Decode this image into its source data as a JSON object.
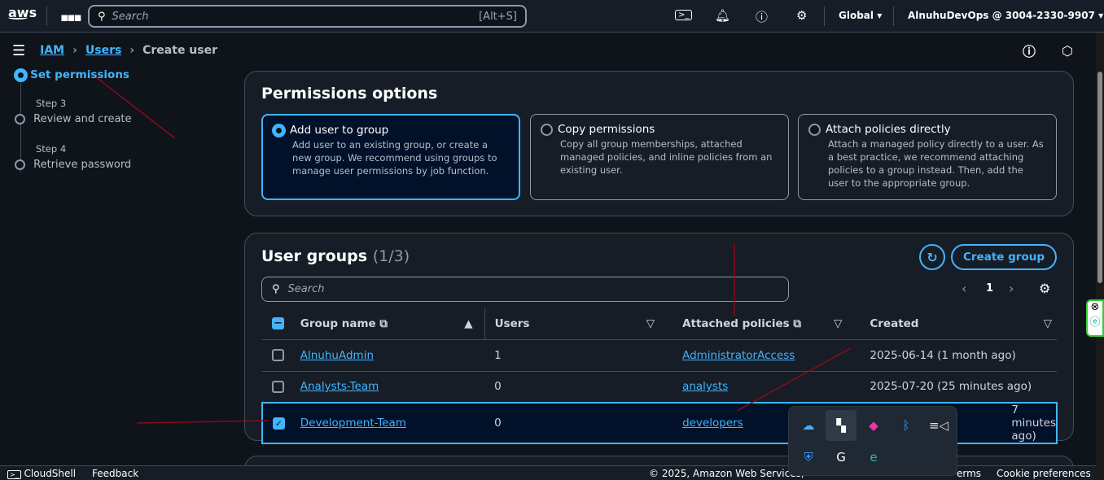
{
  "topbar": {
    "logo": "aws",
    "search_placeholder": "Search",
    "search_shortcut": "[Alt+S]",
    "region": "Global",
    "account": "AlnuhuDevOps @ 3004-2330-9907"
  },
  "breadcrumb": [
    "IAM",
    "Users",
    "Create user"
  ],
  "steps": [
    {
      "title": "Set permissions"
    },
    {
      "num": "Step 3",
      "title": "Review and create"
    },
    {
      "num": "Step 4",
      "title": "Retrieve password"
    }
  ],
  "permissions": {
    "title": "Permissions options",
    "options": [
      {
        "label": "Add user to group",
        "desc": "Add user to an existing group, or create a new group. We recommend using groups to manage user permissions by job function.",
        "selected": true
      },
      {
        "label": "Copy permissions",
        "desc": "Copy all group memberships, attached managed policies, and inline policies from an existing user.",
        "selected": false
      },
      {
        "label": "Attach policies directly",
        "desc": "Attach a managed policy directly to a user. As a best practice, we recommend attaching policies to a group instead. Then, add the user to the appropriate group.",
        "selected": false
      }
    ]
  },
  "groups": {
    "title": "User groups",
    "count": "(1/3)",
    "create_label": "Create group",
    "search_placeholder": "Search",
    "page": "1",
    "columns": [
      "Group name",
      "Users",
      "Attached policies",
      "Created"
    ],
    "rows": [
      {
        "name": "AlnuhuAdmin",
        "users": "1",
        "policy": "AdministratorAccess",
        "created": "2025-06-14 (1 month ago)",
        "checked": false
      },
      {
        "name": "Analysts-Team",
        "users": "0",
        "policy": "analysts",
        "created": "2025-07-20 (25 minutes ago)",
        "checked": false
      },
      {
        "name": "Development-Team",
        "users": "0",
        "policy": "developers",
        "created": "7 minutes ago)",
        "checked": true
      }
    ]
  },
  "footer": {
    "cloudshell": "CloudShell",
    "feedback": "Feedback",
    "copyright": "© 2025, Amazon Web Services,",
    "terms": "erms",
    "cookies": "Cookie preferences"
  },
  "colors": {
    "accent": "#42b4ff",
    "annotation": "#8b0a1a"
  }
}
